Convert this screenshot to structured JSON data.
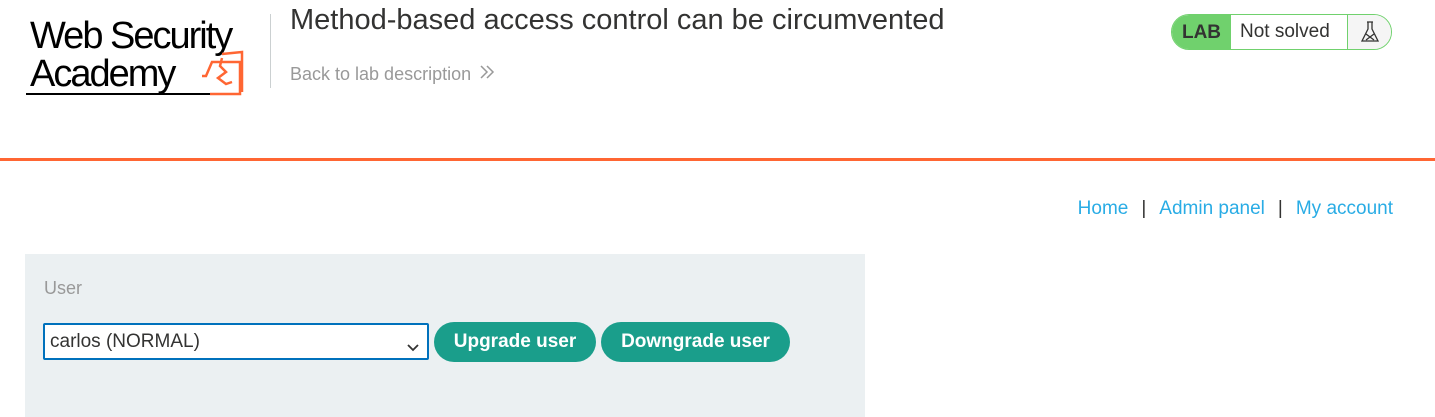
{
  "header": {
    "logo_alt": "Web Security Academy",
    "lab_title": "Method-based access control can be circumvented",
    "back_link": "Back to lab description",
    "lab_status": {
      "badge": "LAB",
      "state": "Not solved"
    }
  },
  "nav": {
    "items": [
      {
        "label": "Home"
      },
      {
        "label": "Admin panel"
      },
      {
        "label": "My account"
      }
    ],
    "separator": "|"
  },
  "admin_form": {
    "label": "User",
    "selected_user": "carlos (NORMAL)",
    "upgrade_button": "Upgrade user",
    "downgrade_button": "Downgrade user"
  },
  "colors": {
    "accent_orange": "#ff6633",
    "link_blue": "#29ace5",
    "status_green": "#70d16d",
    "button_teal": "#1a9e8b",
    "panel_bg": "#ebf0f2"
  }
}
